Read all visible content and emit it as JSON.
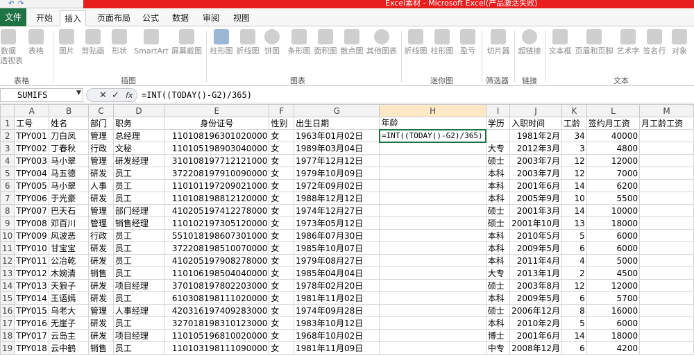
{
  "window": {
    "title": "Excel素材 - Microsoft Excel(产品激活失败)"
  },
  "tabs": [
    {
      "label": "文件"
    },
    {
      "label": "开始"
    },
    {
      "label": "插入"
    },
    {
      "label": "页面布局"
    },
    {
      "label": "公式"
    },
    {
      "label": "数据"
    },
    {
      "label": "审阅"
    },
    {
      "label": "视图"
    }
  ],
  "active_tab": "插入",
  "ribbon": {
    "buttons": {
      "pivot": [
        "数据",
        "透视表"
      ],
      "table": "表格",
      "picture": "图片",
      "clipart": "剪贴画",
      "shapes": "形状",
      "smartart": "SmartArt",
      "screenshot": "屏幕截图",
      "column": "柱形图",
      "line": "折线图",
      "pie": "饼图",
      "bar": "条形图",
      "area": "面积图",
      "scatter": "散点图",
      "other": "其他图表",
      "spark_line": "折线图",
      "spark_col": "柱形图",
      "spark_win": "盈亏",
      "slicer": "切片器",
      "hyperlink": "超链接",
      "textbox": "文本框",
      "header": "页眉和页脚",
      "wordart": "艺术字",
      "signature": "签名行",
      "object": "对象"
    },
    "groups": {
      "tables": "表格",
      "illustrations": "插图",
      "charts": "图表",
      "sparklines": "迷你图",
      "filter": "筛选器",
      "links": "链接",
      "text": "文本"
    }
  },
  "formula_bar": {
    "name_box": "SUMIFS",
    "cancel": "✕",
    "enter": "✓",
    "fx": "fx",
    "formula": "=INT((TODAY()-G2)/365)"
  },
  "columns": [
    "A",
    "B",
    "C",
    "D",
    "E",
    "F",
    "G",
    "H",
    "I",
    "J",
    "K",
    "L",
    "M"
  ],
  "header_row": [
    "工号",
    "姓名",
    "部门",
    "职务",
    "身份证号",
    "性别",
    "出生日期",
    "年龄",
    "学历",
    "入职时间",
    "工龄",
    "签约月工资",
    "月工龄工资"
  ],
  "edit_cell_text": "=INT((TODAY()-G2)/365)",
  "rows": [
    {
      "num": "2",
      "id": "TPY001",
      "name": "刀白凤",
      "dept": "管理",
      "title": "总经理",
      "idcard": "110108196301020000",
      "sex": "女",
      "birth": "1963年01月02日",
      "age": "",
      "edu": "",
      "hire": "1981年2月",
      "years": "34",
      "salary": "40000",
      "yearpay": ""
    },
    {
      "num": "3",
      "id": "TPY002",
      "name": "丁春秋",
      "dept": "行政",
      "title": "文秘",
      "idcard": "110105198903040000",
      "sex": "女",
      "birth": "1989年03月04日",
      "age": "",
      "edu": "大专",
      "hire": "2012年3月",
      "years": "3",
      "salary": "4800",
      "yearpay": ""
    },
    {
      "num": "4",
      "id": "TPY003",
      "name": "马小翠",
      "dept": "管理",
      "title": "研发经理",
      "idcard": "310108197712121000",
      "sex": "女",
      "birth": "1977年12月12日",
      "age": "",
      "edu": "硕士",
      "hire": "2003年7月",
      "years": "12",
      "salary": "12000",
      "yearpay": ""
    },
    {
      "num": "5",
      "id": "TPY004",
      "name": "马五德",
      "dept": "研发",
      "title": "员工",
      "idcard": "372208197910090000",
      "sex": "女",
      "birth": "1979年10月09日",
      "age": "",
      "edu": "本科",
      "hire": "2003年7月",
      "years": "12",
      "salary": "7000",
      "yearpay": ""
    },
    {
      "num": "6",
      "id": "TPY005",
      "name": "马小翠",
      "dept": "人事",
      "title": "员工",
      "idcard": "110101197209021000",
      "sex": "女",
      "birth": "1972年09月02日",
      "age": "",
      "edu": "本科",
      "hire": "2001年6月",
      "years": "14",
      "salary": "6200",
      "yearpay": ""
    },
    {
      "num": "7",
      "id": "TPY006",
      "name": "于光豪",
      "dept": "研发",
      "title": "员工",
      "idcard": "110108198812120000",
      "sex": "女",
      "birth": "1988年12月12日",
      "age": "",
      "edu": "本科",
      "hire": "2005年9月",
      "years": "10",
      "salary": "5500",
      "yearpay": ""
    },
    {
      "num": "8",
      "id": "TPY007",
      "name": "巴天石",
      "dept": "管理",
      "title": "部门经理",
      "idcard": "410205197412278000",
      "sex": "女",
      "birth": "1974年12月27日",
      "age": "",
      "edu": "硕士",
      "hire": "2001年3月",
      "years": "14",
      "salary": "10000",
      "yearpay": ""
    },
    {
      "num": "9",
      "id": "TPY008",
      "name": "邓百川",
      "dept": "管理",
      "title": "销售经理",
      "idcard": "110102197305120000",
      "sex": "女",
      "birth": "1973年05月12日",
      "age": "",
      "edu": "硕士",
      "hire": "2001年10月",
      "years": "13",
      "salary": "18000",
      "yearpay": ""
    },
    {
      "num": "10",
      "id": "TPY009",
      "name": "风波恶",
      "dept": "行政",
      "title": "员工",
      "idcard": "551018198607301000",
      "sex": "女",
      "birth": "1986年07月30日",
      "age": "",
      "edu": "本科",
      "hire": "2010年5月",
      "years": "5",
      "salary": "6000",
      "yearpay": ""
    },
    {
      "num": "11",
      "id": "TPY010",
      "name": "甘宝宝",
      "dept": "研发",
      "title": "员工",
      "idcard": "372208198510070000",
      "sex": "女",
      "birth": "1985年10月07日",
      "age": "",
      "edu": "本科",
      "hire": "2009年5月",
      "years": "6",
      "salary": "6000",
      "yearpay": ""
    },
    {
      "num": "12",
      "id": "TPY011",
      "name": "公冶乾",
      "dept": "研发",
      "title": "员工",
      "idcard": "410205197908278000",
      "sex": "女",
      "birth": "1979年08月27日",
      "age": "",
      "edu": "本科",
      "hire": "2011年4月",
      "years": "4",
      "salary": "5000",
      "yearpay": ""
    },
    {
      "num": "13",
      "id": "TPY012",
      "name": "木婉清",
      "dept": "销售",
      "title": "员工",
      "idcard": "110106198504040000",
      "sex": "女",
      "birth": "1985年04月04日",
      "age": "",
      "edu": "大专",
      "hire": "2013年1月",
      "years": "2",
      "salary": "4500",
      "yearpay": ""
    },
    {
      "num": "14",
      "id": "TPY013",
      "name": "天狼子",
      "dept": "研发",
      "title": "项目经理",
      "idcard": "370108197802203000",
      "sex": "女",
      "birth": "1978年02月20日",
      "age": "",
      "edu": "硕士",
      "hire": "2003年8月",
      "years": "12",
      "salary": "12000",
      "yearpay": ""
    },
    {
      "num": "15",
      "id": "TPY014",
      "name": "王语嫣",
      "dept": "研发",
      "title": "员工",
      "idcard": "610308198111020000",
      "sex": "女",
      "birth": "1981年11月02日",
      "age": "",
      "edu": "本科",
      "hire": "2009年5月",
      "years": "6",
      "salary": "5700",
      "yearpay": ""
    },
    {
      "num": "16",
      "id": "TPY015",
      "name": "乌老大",
      "dept": "管理",
      "title": "人事经理",
      "idcard": "420316197409283000",
      "sex": "女",
      "birth": "1974年09月28日",
      "age": "",
      "edu": "硕士",
      "hire": "2006年12月",
      "years": "8",
      "salary": "16000",
      "yearpay": ""
    },
    {
      "num": "17",
      "id": "TPY016",
      "name": "无崖子",
      "dept": "研发",
      "title": "员工",
      "idcard": "327018198310123000",
      "sex": "女",
      "birth": "1983年10月12日",
      "age": "",
      "edu": "本科",
      "hire": "2010年2月",
      "years": "5",
      "salary": "6000",
      "yearpay": ""
    },
    {
      "num": "18",
      "id": "TPY017",
      "name": "云岛主",
      "dept": "研发",
      "title": "项目经理",
      "idcard": "110105196810020000",
      "sex": "女",
      "birth": "1968年10月02日",
      "age": "",
      "edu": "博士",
      "hire": "2001年6月",
      "years": "14",
      "salary": "18000",
      "yearpay": ""
    },
    {
      "num": "19",
      "id": "TPY018",
      "name": "云中鹤",
      "dept": "销售",
      "title": "员工",
      "idcard": "110103198111090000",
      "sex": "女",
      "birth": "1981年11月09日",
      "age": "",
      "edu": "中专",
      "hire": "2008年12月",
      "years": "6",
      "salary": "4200",
      "yearpay": ""
    }
  ],
  "colors": {
    "title_bar": "#e81e1e",
    "file_tab": "#1f7244",
    "formula_paren": "#7b2bbf",
    "selected_header": "#fde9c6"
  },
  "icons": [
    "undo-icon",
    "redo-icon",
    "cancel-icon",
    "enter-icon",
    "function-icon",
    "dropdown-icon"
  ]
}
